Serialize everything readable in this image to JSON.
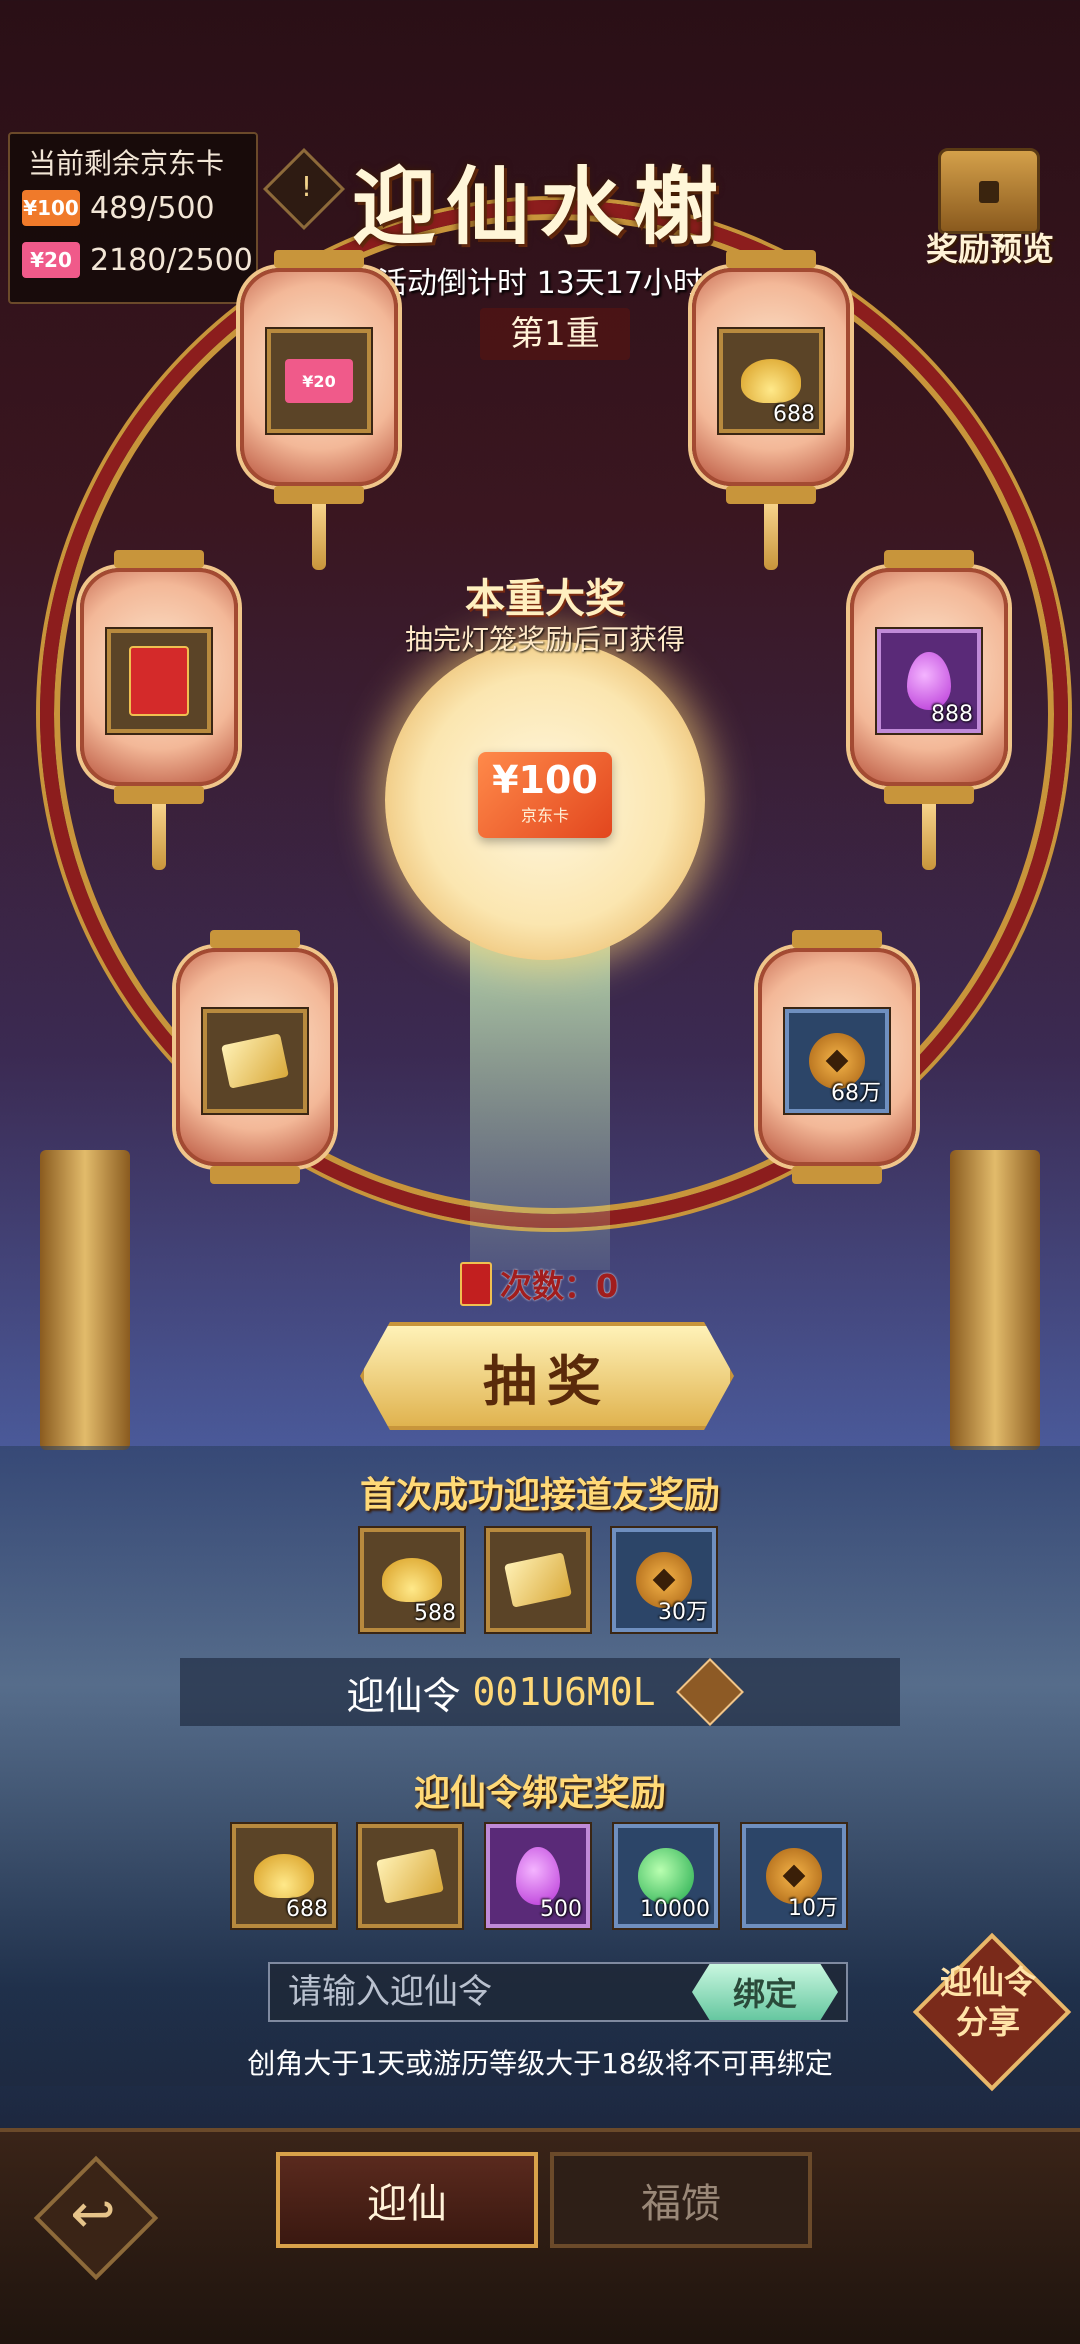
{
  "jd_card_panel": {
    "title": "当前剩余京东卡",
    "rows": [
      {
        "tag": "¥100",
        "tag_color": "#f07a2a",
        "value": "489/500"
      },
      {
        "tag": "¥20",
        "tag_color": "#f05a8a",
        "value": "2180/2500"
      }
    ]
  },
  "header": {
    "info_icon": "!",
    "title": "迎仙水榭",
    "countdown": "活动倒计时 13天17小时",
    "layer": "第1重",
    "reward_preview_label": "奖励预览"
  },
  "lanterns": [
    {
      "item": "pink-card",
      "label": "¥20",
      "count": ""
    },
    {
      "item": "gold-ingot",
      "count": "688"
    },
    {
      "item": "red-envelope",
      "count": ""
    },
    {
      "item": "purple-crystal",
      "count": "888"
    },
    {
      "item": "gold-tickets",
      "count": ""
    },
    {
      "item": "copper-coin",
      "count": "68万"
    }
  ],
  "grand_prize": {
    "title": "本重大奖",
    "subtitle": "抽完灯笼奖励后可获得",
    "card_value": "¥100",
    "card_brand": "京东卡"
  },
  "draw": {
    "tries_label": "次数：0",
    "button": "抽奖"
  },
  "first_success": {
    "title": "首次成功迎接道友奖励",
    "items": [
      {
        "item": "gold-ingot",
        "count": "588"
      },
      {
        "item": "gold-tickets",
        "count": ""
      },
      {
        "item": "copper-coin",
        "count": "30万"
      }
    ]
  },
  "code": {
    "label": "迎仙令",
    "value": "001U6M0L"
  },
  "binding": {
    "title": "迎仙令绑定奖励",
    "items": [
      {
        "item": "gold-ingot",
        "count": "688"
      },
      {
        "item": "gold-tickets",
        "count": ""
      },
      {
        "item": "purple-crystal",
        "count": "500"
      },
      {
        "item": "green-orb",
        "count": "10000"
      },
      {
        "item": "copper-coin",
        "count": "10万"
      }
    ],
    "placeholder": "请输入迎仙令",
    "bind_button": "绑定",
    "notice": "创角大于1天或游历等级大于18级将不可再绑定",
    "share_label_1": "迎仙令",
    "share_label_2": "分享"
  },
  "bottom_tabs": {
    "back_icon": "↩",
    "tab_active": "迎仙",
    "tab_inactive": "福馈"
  }
}
